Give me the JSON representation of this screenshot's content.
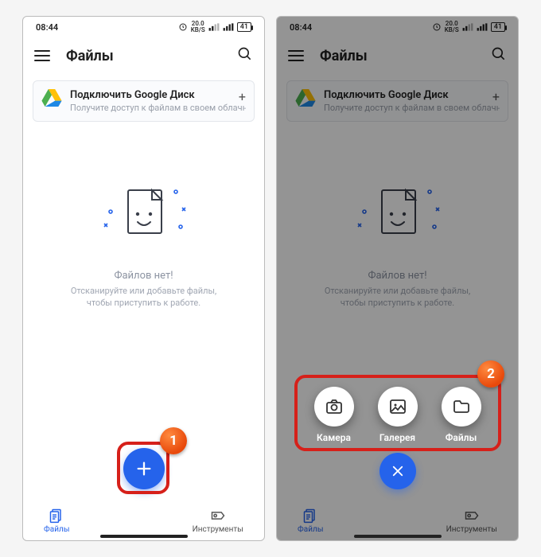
{
  "statusbar": {
    "time": "08:44",
    "net": "20.0",
    "net_unit": "KB/S",
    "battery": "41"
  },
  "appbar": {
    "title": "Файлы"
  },
  "drive": {
    "title": "Подключить Google Диск",
    "sub": "Получите доступ к файлам в своем облачном хранилище"
  },
  "empty": {
    "title": "Файлов нет!",
    "sub": "Отсканируйте или добавьте файлы, чтобы приступить к работе."
  },
  "bottom": {
    "files": "Файлы",
    "tools": "Инструменты"
  },
  "actions": {
    "camera": "Камера",
    "gallery": "Галерея",
    "files": "Файлы"
  },
  "badges": {
    "one": "1",
    "two": "2"
  }
}
